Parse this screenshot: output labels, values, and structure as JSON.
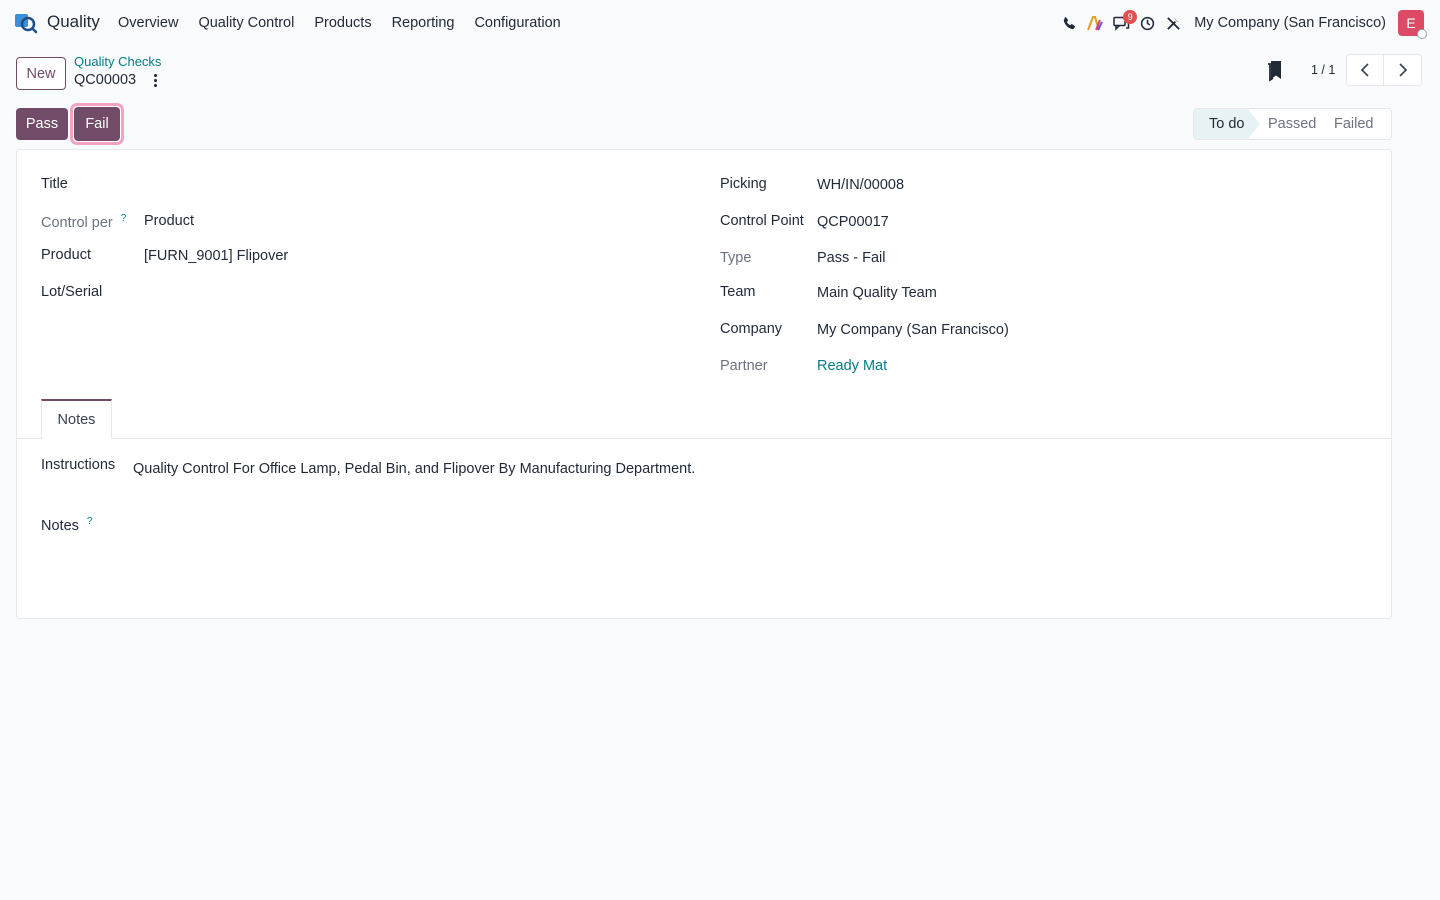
{
  "navbar": {
    "app_name": "Quality",
    "menu": [
      "Overview",
      "Quality Control",
      "Products",
      "Reporting",
      "Configuration"
    ],
    "messages_count": "9",
    "company": "My Company (San Francisco)",
    "avatar_initial": "E",
    "icons": [
      "phone-icon",
      "ai-icon",
      "chat-icon",
      "clock-icon",
      "tools-icon"
    ]
  },
  "control_panel": {
    "new_label": "New",
    "breadcrumb_parent": "Quality Checks",
    "record_name": "QC00003",
    "pager_value": "1 / 1"
  },
  "statusbar": {
    "pass_label": "Pass",
    "fail_label": "Fail",
    "stages": [
      "To do",
      "Passed",
      "Failed"
    ],
    "current_stage": "To do"
  },
  "form": {
    "left": {
      "title_label": "Title",
      "control_per_label": "Control per",
      "control_per_value": "Product",
      "product_label": "Product",
      "product_value": "[FURN_9001] Flipover",
      "lot_label": "Lot/Serial"
    },
    "right": {
      "picking_label": "Picking",
      "picking_value": "WH/IN/00008",
      "control_point_label": "Control Point",
      "control_point_value": "QCP00017",
      "type_label": "Type",
      "type_value": "Pass - Fail",
      "team_label": "Team",
      "team_value": "Main Quality Team",
      "company_label": "Company",
      "company_value": "My Company (San Francisco)",
      "partner_label": "Partner",
      "partner_value": "Ready Mat"
    },
    "help_mark": "?",
    "notes_tab": {
      "label": "Notes",
      "instructions_label": "Instructions",
      "instructions_value": "Quality Control For Office Lamp, Pedal Bin, and Flipover By Manufacturing Department.",
      "notes_label": "Notes"
    }
  },
  "colors": {
    "brand": "#714b67",
    "link": "#017e84",
    "avatar": "#dc4a66",
    "focus_ring": "#f2a2c2"
  }
}
